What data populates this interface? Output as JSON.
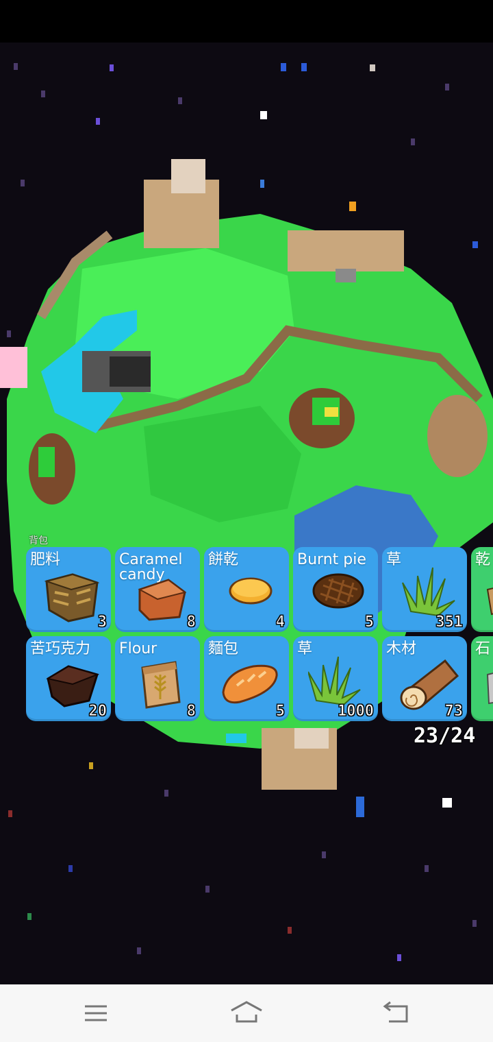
{
  "inventory": {
    "title": "背包",
    "capacity": "23/24",
    "slots": [
      {
        "name": "肥料",
        "count": "3",
        "icon": "fertilizer-crate-icon",
        "color": "#3aa2ec"
      },
      {
        "name": "Caramel\ncandy",
        "count": "8",
        "icon": "caramel-candy-icon",
        "color": "#3aa2ec"
      },
      {
        "name": "餅乾",
        "count": "4",
        "icon": "cookie-icon",
        "color": "#3aa2ec"
      },
      {
        "name": "Burnt pie",
        "count": "5",
        "icon": "burnt-pie-icon",
        "color": "#3aa2ec"
      },
      {
        "name": "草",
        "count": "351",
        "icon": "grass-icon",
        "color": "#3aa2ec"
      },
      {
        "name": "乾",
        "count": "",
        "icon": "partial-item-icon",
        "color": "#3ecf6e"
      },
      {
        "name": "苦巧克力",
        "count": "20",
        "icon": "dark-chocolate-icon",
        "color": "#3aa2ec"
      },
      {
        "name": "Flour",
        "count": "8",
        "icon": "flour-bag-icon",
        "color": "#3aa2ec"
      },
      {
        "name": "麵包",
        "count": "5",
        "icon": "bread-icon",
        "color": "#3aa2ec"
      },
      {
        "name": "草",
        "count": "1000",
        "icon": "grass-icon",
        "color": "#3aa2ec"
      },
      {
        "name": "木材",
        "count": "73",
        "icon": "wood-log-icon",
        "color": "#3aa2ec"
      },
      {
        "name": "石",
        "count": "",
        "icon": "partial-item-icon",
        "color": "#3ecf6e"
      }
    ]
  },
  "navbar": {
    "menu_icon": "menu-icon",
    "home_icon": "home-icon",
    "back_icon": "back-icon"
  }
}
